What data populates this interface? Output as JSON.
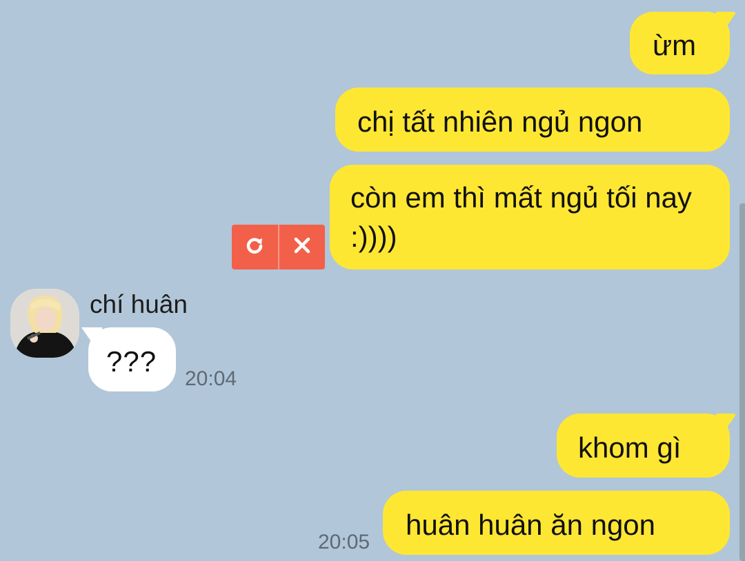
{
  "chat": {
    "contact_name": "chí huân",
    "messages": [
      {
        "id": "m1",
        "from": "me",
        "text": "ừm"
      },
      {
        "id": "m2",
        "from": "me",
        "text": "chị tất nhiên ngủ ngon"
      },
      {
        "id": "m3",
        "from": "me",
        "text": "còn em thì mất ngủ tối nay :))))",
        "status": "failed"
      },
      {
        "id": "m4",
        "from": "them",
        "text": "???",
        "time": "20:04"
      },
      {
        "id": "m5",
        "from": "me",
        "text": "khom gì"
      },
      {
        "id": "m6",
        "from": "me",
        "text": "huân huân ăn ngon",
        "time": "20:05"
      }
    ]
  },
  "failed_actions": {
    "retry_icon": "retry-icon",
    "delete_icon": "close-icon"
  },
  "colors": {
    "background": "#b1c6d8",
    "my_bubble": "#fee733",
    "their_bubble": "#ffffff",
    "failed_action_bg": "#f2604a",
    "timestamp": "#5d6a76"
  }
}
